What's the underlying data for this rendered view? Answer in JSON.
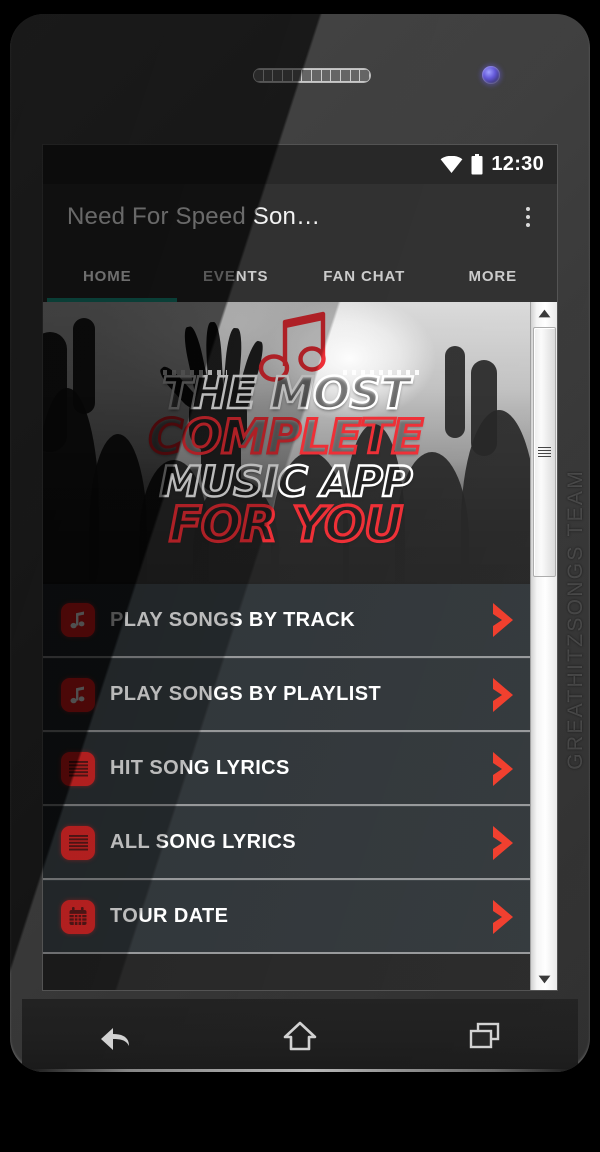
{
  "device": {
    "bezel_brand_text": "GREATHITZSONGS TEAM",
    "hardware": {
      "speaker_name": "earpiece-speaker-grille",
      "camera_name": "front-camera-lens"
    }
  },
  "status_bar": {
    "time": "12:30",
    "icons": [
      "wifi-icon",
      "battery-icon"
    ]
  },
  "action_bar": {
    "title": "Need For Speed Son…",
    "overflow_label": "overflow-menu"
  },
  "tabs": {
    "active_index": 0,
    "items": [
      {
        "label": "HOME"
      },
      {
        "label": "EVENTS"
      },
      {
        "label": "FAN CHAT"
      },
      {
        "label": "MORE"
      }
    ],
    "indicator_color": "#17907f"
  },
  "banner": {
    "lines": [
      {
        "text": "THE MOST",
        "color": "#ffffff"
      },
      {
        "text": "COMPLETE",
        "color": "#ec1c24"
      },
      {
        "text": "MUSIC APP",
        "color": "#ffffff"
      },
      {
        "text": "FOR YOU",
        "color": "#ec1c24"
      }
    ],
    "icon": "music-note-icon",
    "image_description": "grayscale concert crowd with raised hands"
  },
  "menu": {
    "items": [
      {
        "label": "PLAY SONGS BY TRACK",
        "icon": "music-note-icon"
      },
      {
        "label": "PLAY SONGS BY PLAYLIST",
        "icon": "music-note-icon"
      },
      {
        "label": "HIT SONG LYRICS",
        "icon": "lyrics-lines-icon"
      },
      {
        "label": "ALL SONG LYRICS",
        "icon": "lyrics-lines-icon"
      },
      {
        "label": "TOUR DATE",
        "icon": "calendar-icon"
      }
    ],
    "accent_color": "#f21b1b",
    "row_background": "#1f2529",
    "chevron_icon": "chevron-right-icon"
  },
  "scrollbar": {
    "up_icon": "scroll-up-arrow-icon",
    "down_icon": "scroll-down-arrow-icon",
    "thumb_name": "scrollbar-thumb"
  },
  "nav_bar": {
    "buttons": [
      {
        "name": "back-icon"
      },
      {
        "name": "home-icon"
      },
      {
        "name": "recents-icon"
      }
    ]
  }
}
